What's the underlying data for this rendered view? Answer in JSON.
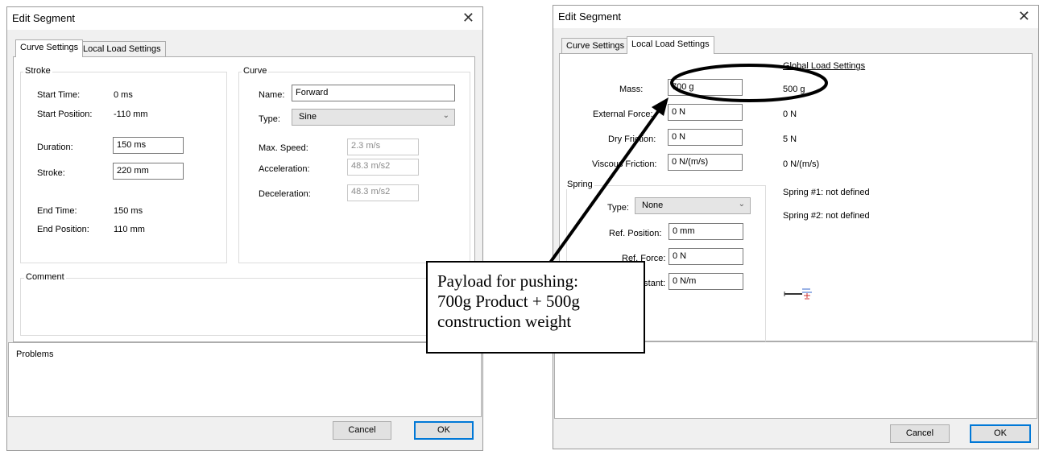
{
  "left": {
    "title": "Edit Segment",
    "tabs": [
      "Curve Settings",
      "Local Load Settings"
    ],
    "stroke": {
      "group_label": "Stroke",
      "start_time_label": "Start Time:",
      "start_time": "0 ms",
      "start_position_label": "Start Position:",
      "start_position": "-110 mm",
      "duration_label": "Duration:",
      "duration": "150 ms",
      "stroke_label": "Stroke:",
      "stroke": "220 mm",
      "end_time_label": "End Time:",
      "end_time": "150 ms",
      "end_position_label": "End Position:",
      "end_position": "110 mm"
    },
    "curve": {
      "group_label": "Curve",
      "name_label": "Name:",
      "name": "Forward",
      "type_label": "Type:",
      "type": "Sine",
      "max_speed_label": "Max. Speed:",
      "max_speed": "2.3 m/s",
      "acceleration_label": "Acceleration:",
      "acceleration": "48.3 m/s2",
      "deceleration_label": "Deceleration:",
      "deceleration": "48.3 m/s2"
    },
    "comment_label": "Comment",
    "problems_label": "Problems",
    "cancel": "Cancel",
    "ok": "OK"
  },
  "right": {
    "title": "Edit Segment",
    "tabs": [
      "Curve Settings",
      "Local Load Settings"
    ],
    "global_header": "Global Load Settings",
    "mass_label": "Mass:",
    "mass": "700 g",
    "global_mass": "500 g",
    "external_force_label": "External Force:",
    "external_force": "0 N",
    "global_external_force": "0 N",
    "dry_friction_label": "Dry Friction:",
    "dry_friction": "0 N",
    "global_dry_friction": "5 N",
    "viscous_friction_label": "Viscous Friction:",
    "viscous_friction": "0 N/(m/s)",
    "global_viscous_friction": "0 N/(m/s)",
    "spring": {
      "group_label": "Spring",
      "type_label": "Type:",
      "type": "None",
      "ref_position_label": "Ref. Position:",
      "ref_position": "0 mm",
      "ref_force_label": "Ref. Force:",
      "ref_force": "0 N",
      "constant_label": "Constant:",
      "constant": "0 N/m"
    },
    "spring1": "Spring #1: not defined",
    "spring2": "Spring #2: not defined",
    "cancel": "Cancel",
    "ok": "OK"
  },
  "callout": {
    "lines": [
      "Payload for pushing:",
      "700g Product + 500g",
      "construction weight"
    ]
  },
  "colors": {
    "accent": "#0078d7",
    "dialog_bg": "#f0f0f0"
  }
}
